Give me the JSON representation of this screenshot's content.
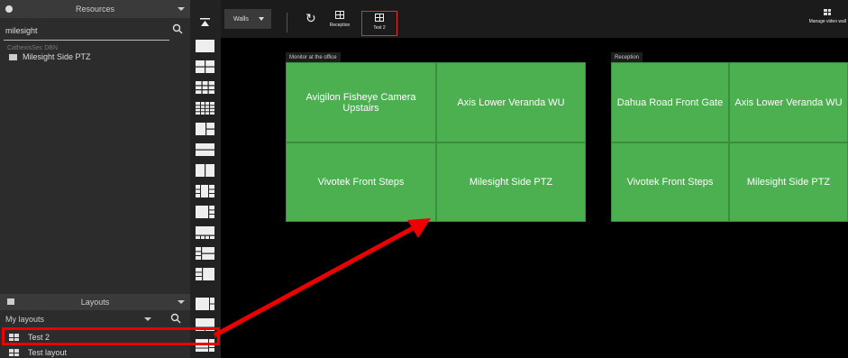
{
  "resources": {
    "title": "Resources",
    "search_value": "milesight",
    "group": "CathexisSec DBN",
    "items": [
      "Milesight Side PTZ"
    ]
  },
  "layouts": {
    "title": "Layouts",
    "filter": "My layouts",
    "items": [
      "Test 2",
      "Test layout"
    ]
  },
  "topbar": {
    "walls_label": "Walls",
    "buttons": [
      "Reception",
      "Test 2"
    ],
    "manage_label": "Manage video wall"
  },
  "walls": [
    {
      "name": "Monitor at the office",
      "tiles": [
        "Avigilon Fisheye Camera Upstairs",
        "Axis Lower Veranda WU",
        "Vivotek Front Steps",
        "Milesight Side PTZ"
      ]
    },
    {
      "name": "Reception",
      "tiles": [
        "Dahua Road Front Gate",
        "Axis Lower Veranda WU",
        "Vivotek Front Steps",
        "Milesight Side PTZ"
      ]
    }
  ],
  "colors": {
    "tile": "#4caf50",
    "annotation": "#ee0000"
  }
}
